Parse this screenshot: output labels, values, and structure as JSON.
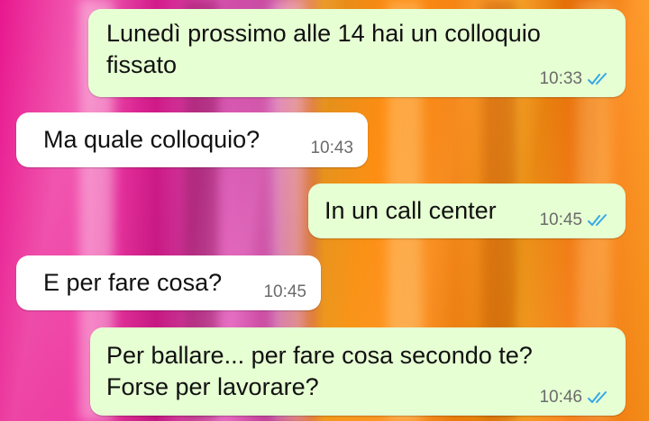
{
  "colors": {
    "outgoing_bubble": "#e6ffd3",
    "incoming_bubble": "#ffffff",
    "read_ticks": "#34a8e8",
    "timestamp": "#6b6b6b"
  },
  "messages": [
    {
      "direction": "outgoing",
      "text": "Lunedì prossimo alle 14 hai un colloquio\nfissato",
      "time": "10:33",
      "status_icon": "double-check-read-icon"
    },
    {
      "direction": "incoming",
      "text": "Ma quale colloquio?",
      "time": "10:43"
    },
    {
      "direction": "outgoing",
      "text": "In un call center",
      "time": "10:45",
      "status_icon": "double-check-read-icon"
    },
    {
      "direction": "incoming",
      "text": "E per fare cosa?",
      "time": "10:45"
    },
    {
      "direction": "outgoing",
      "text": "Per ballare... per fare cosa secondo te?\nForse per lavorare?",
      "time": "10:46",
      "status_icon": "double-check-read-icon"
    }
  ]
}
